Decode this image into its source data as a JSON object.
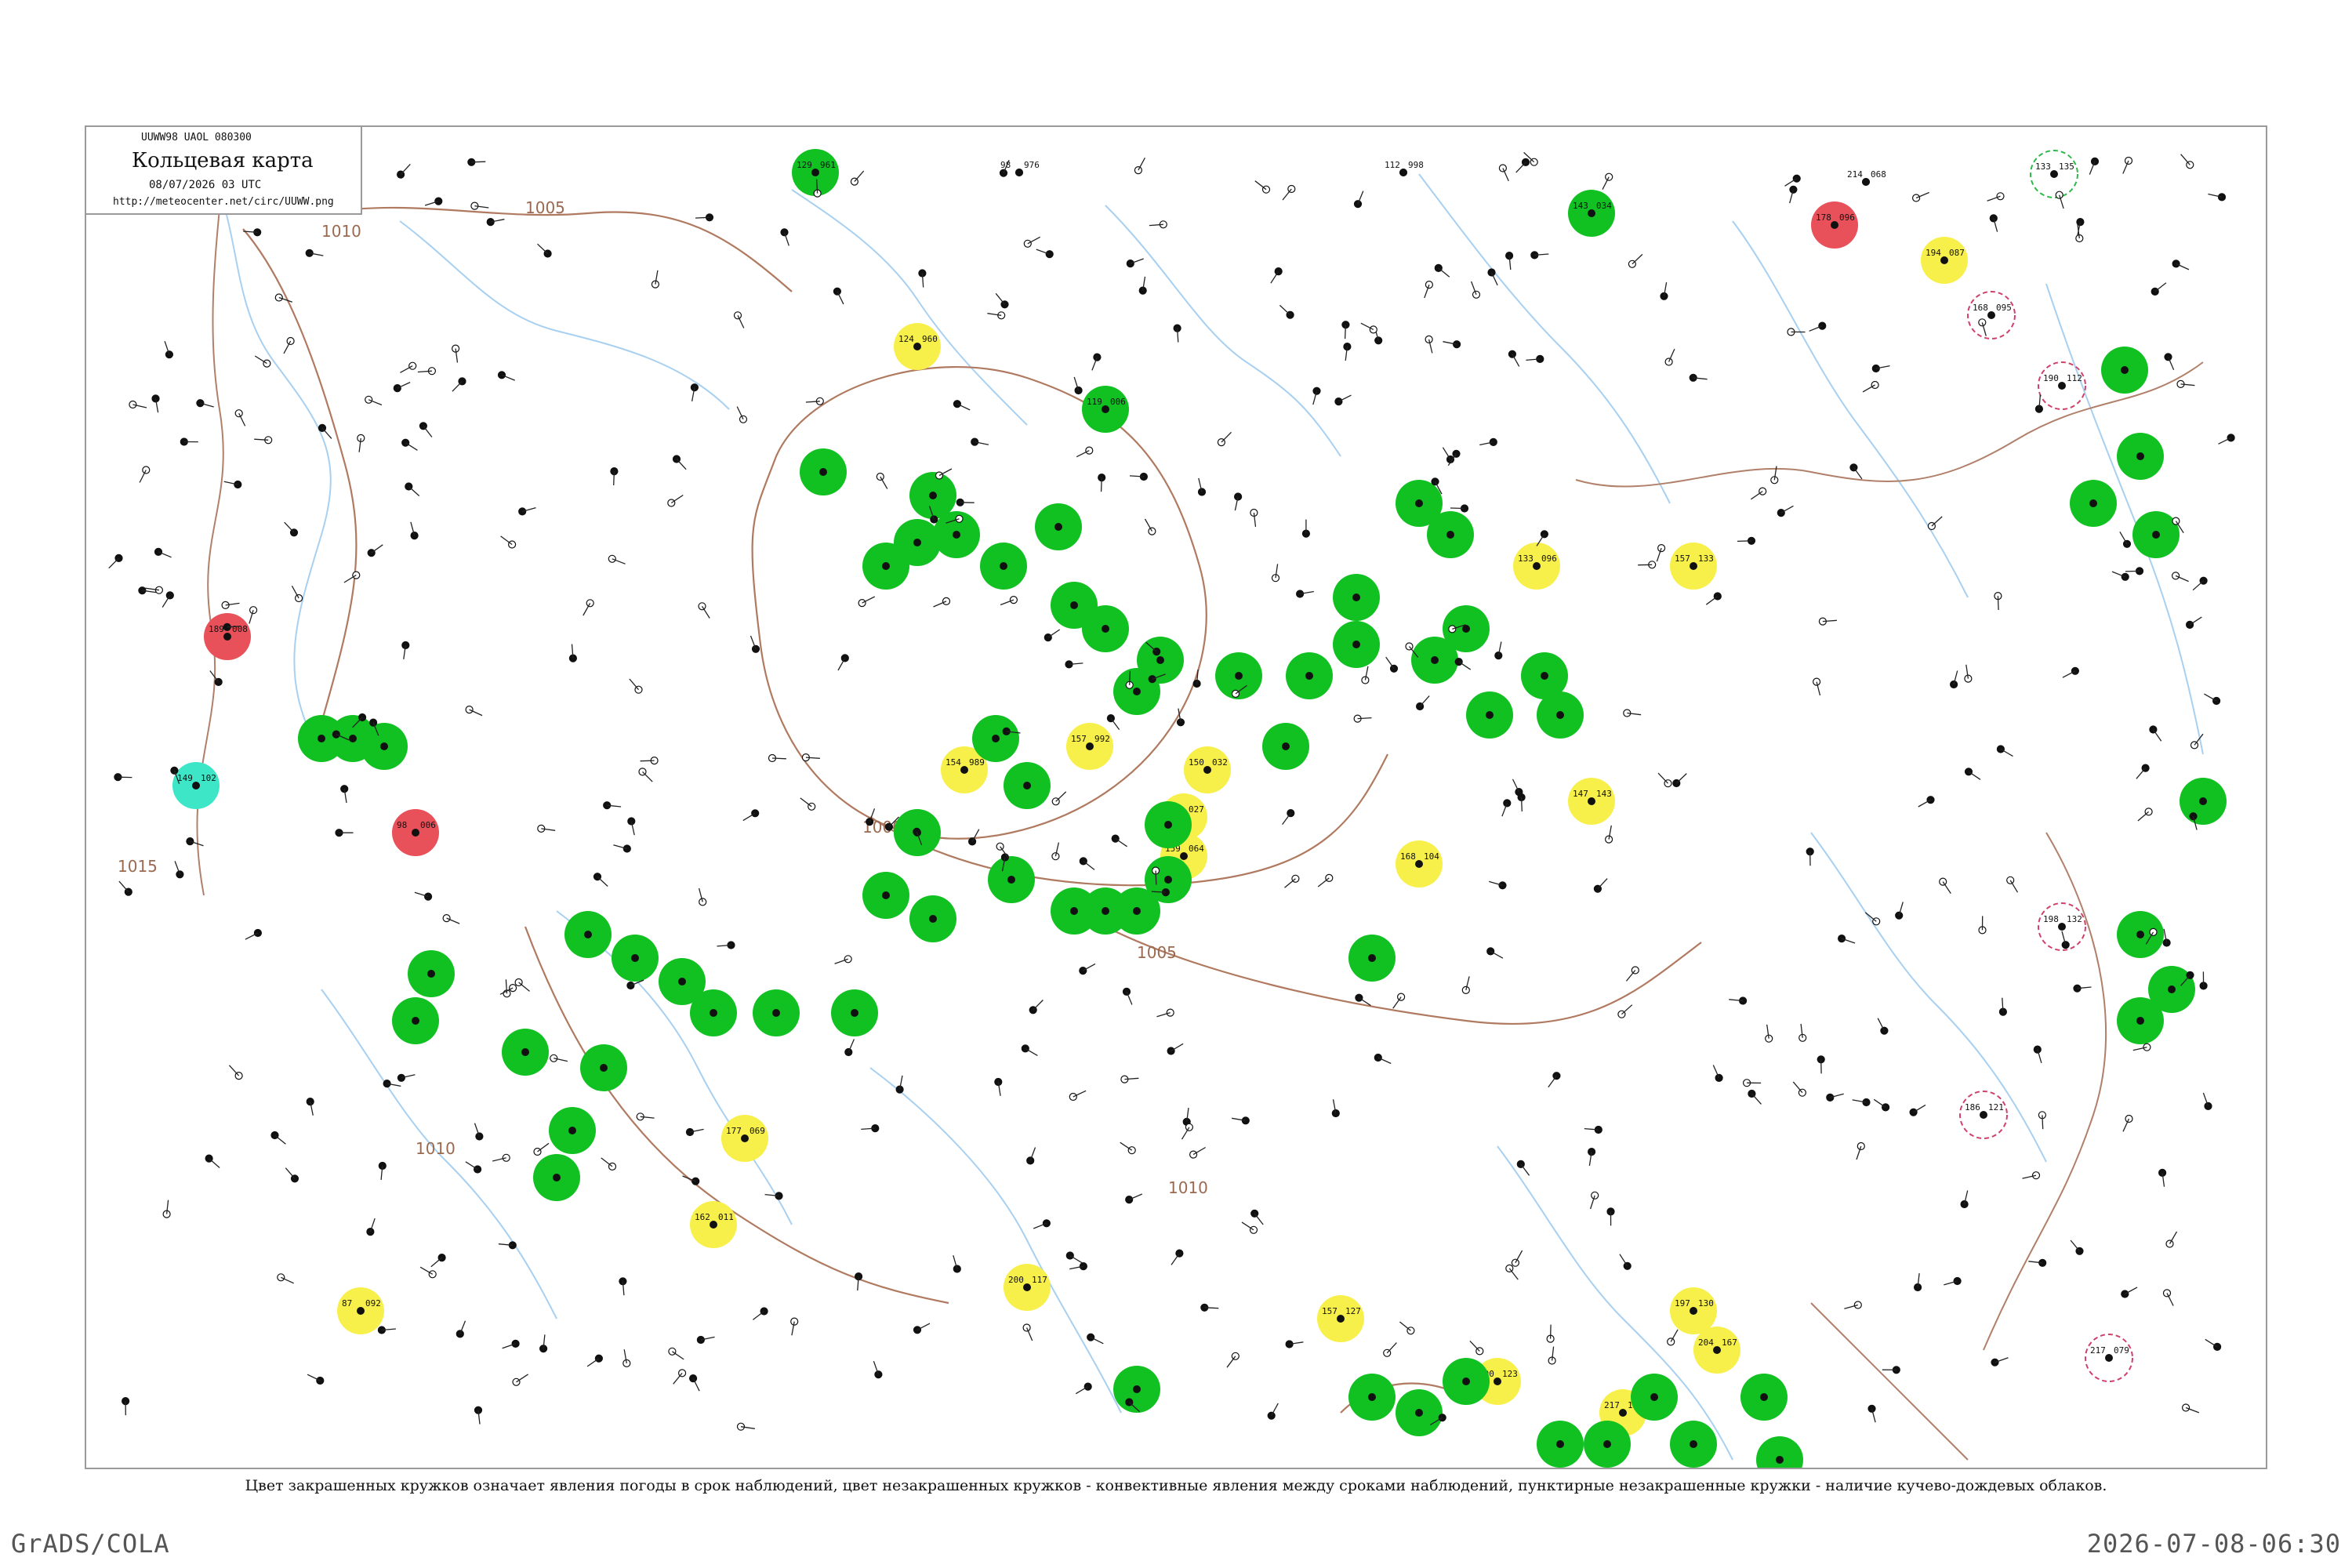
{
  "header": {
    "bulletin": "UUWW98  UAOL  080300",
    "title": "Кольцевая карта",
    "datetime": "08/07/2026 03 UTC",
    "url": "http://meteocenter.net/circ/UUWW.png"
  },
  "caption": "Цвет закрашенных кружков означает явления погоды в срок наблюдений, цвет незакрашенных кружков - конвективные явления между сроками наблюдений, пунктирные незакрашенные кружки - наличие кучево-дождевых облаков.",
  "footer": {
    "left": "GrADS/COLA",
    "right": "2026-07-08-06:30"
  },
  "colors": {
    "green": "#11c122",
    "yellow": "#f8f04a",
    "red": "#e8505a",
    "cyan": "#3ee6c8",
    "isobar": "#b07a60",
    "river": "#9ec9ee",
    "outline_green": "#2db84a",
    "outline_red": "#d0406a"
  },
  "isobars": [
    "1010",
    "1005",
    "1000",
    "1005",
    "1010",
    "1010",
    "1015"
  ],
  "stations": [
    {
      "t": "129",
      "p": "961",
      "c": "green"
    },
    {
      "t": "98",
      "p": "976",
      "c": "none"
    },
    {
      "t": "112",
      "p": "998",
      "c": "none"
    },
    {
      "t": "143",
      "p": "034",
      "c": "green"
    },
    {
      "t": "214",
      "p": "068",
      "c": "none"
    },
    {
      "t": "133",
      "p": "135",
      "c": "outline-green"
    },
    {
      "t": "178",
      "p": "096",
      "c": "red"
    },
    {
      "t": "194",
      "p": "087",
      "c": "yellow"
    },
    {
      "t": "168",
      "p": "095",
      "c": "outline-red"
    },
    {
      "t": "124",
      "p": "960",
      "c": "yellow"
    },
    {
      "t": "119",
      "p": "006",
      "c": "green"
    },
    {
      "t": "133",
      "p": "096",
      "c": "yellow"
    },
    {
      "t": "157",
      "p": "133",
      "c": "yellow"
    },
    {
      "t": "189",
      "p": "008",
      "c": "red"
    },
    {
      "t": "149",
      "p": "102",
      "c": "cyan"
    },
    {
      "t": "157",
      "p": "992",
      "c": "yellow"
    },
    {
      "t": "159",
      "p": "027",
      "c": "yellow"
    },
    {
      "t": "150",
      "p": "032",
      "c": "yellow"
    },
    {
      "t": "168",
      "p": "104",
      "c": "yellow"
    },
    {
      "t": "147",
      "p": "143",
      "c": "yellow"
    },
    {
      "t": "154",
      "p": "989",
      "c": "yellow"
    },
    {
      "t": "159",
      "p": "064",
      "c": "yellow"
    },
    {
      "t": "200",
      "p": "117",
      "c": "yellow"
    },
    {
      "t": "157",
      "p": "127",
      "c": "yellow"
    },
    {
      "t": "197",
      "p": "130",
      "c": "yellow"
    },
    {
      "t": "204",
      "p": "167",
      "c": "yellow"
    },
    {
      "t": "200",
      "p": "123",
      "c": "yellow"
    },
    {
      "t": "217",
      "p": "125",
      "c": "yellow"
    },
    {
      "t": "87",
      "p": "092",
      "c": "yellow"
    },
    {
      "t": "162",
      "p": "011",
      "c": "yellow"
    },
    {
      "t": "177",
      "p": "069",
      "c": "yellow"
    },
    {
      "t": "98",
      "p": "006",
      "c": "red"
    },
    {
      "t": "186",
      "p": "121",
      "c": "outline-red"
    },
    {
      "t": "217",
      "p": "079",
      "c": "outline-red"
    },
    {
      "t": "190",
      "p": "112",
      "c": "outline-red"
    },
    {
      "t": "198",
      "p": "132",
      "c": "outline-red"
    }
  ]
}
